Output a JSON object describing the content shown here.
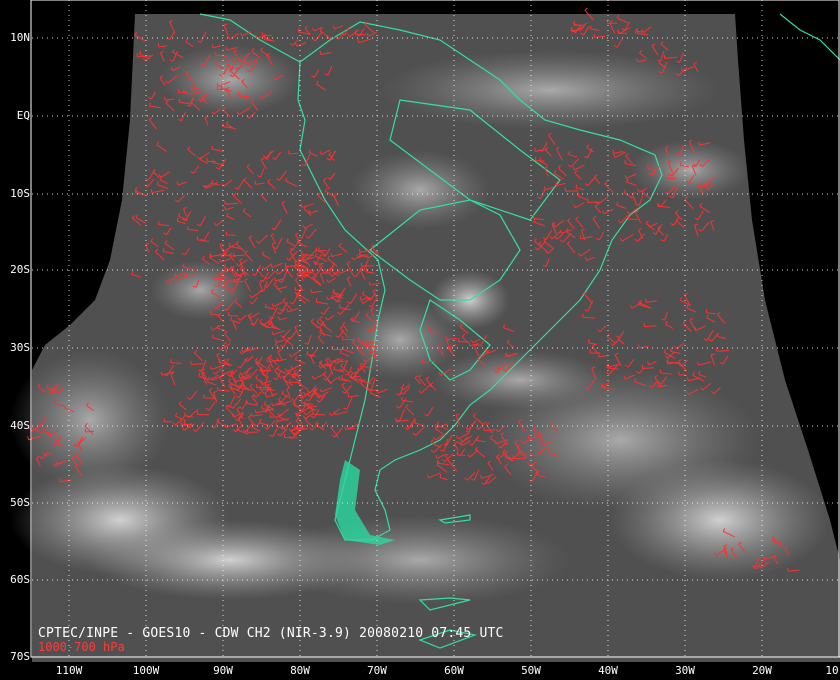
{
  "caption": "CPTEC/INPE - GOES10 - CDW CH2 (NIR-3.9) 20080210 07:45 UTC",
  "subcaption": "1000-700 hPa",
  "lat_labels": [
    "10N",
    "EQ",
    "10S",
    "20S",
    "30S",
    "40S",
    "50S",
    "60S",
    "70S"
  ],
  "lon_labels": [
    "110W",
    "100W",
    "90W",
    "80W",
    "70W",
    "60W",
    "50W",
    "40W",
    "30W",
    "20W",
    "10"
  ],
  "colors": {
    "background": "#000000",
    "land_outline": "#33e0a0",
    "wind_barbs": "#ff3030",
    "grid": "#ffffff",
    "caption": "#ffffff",
    "subcaption": "#ff3b3b"
  }
}
